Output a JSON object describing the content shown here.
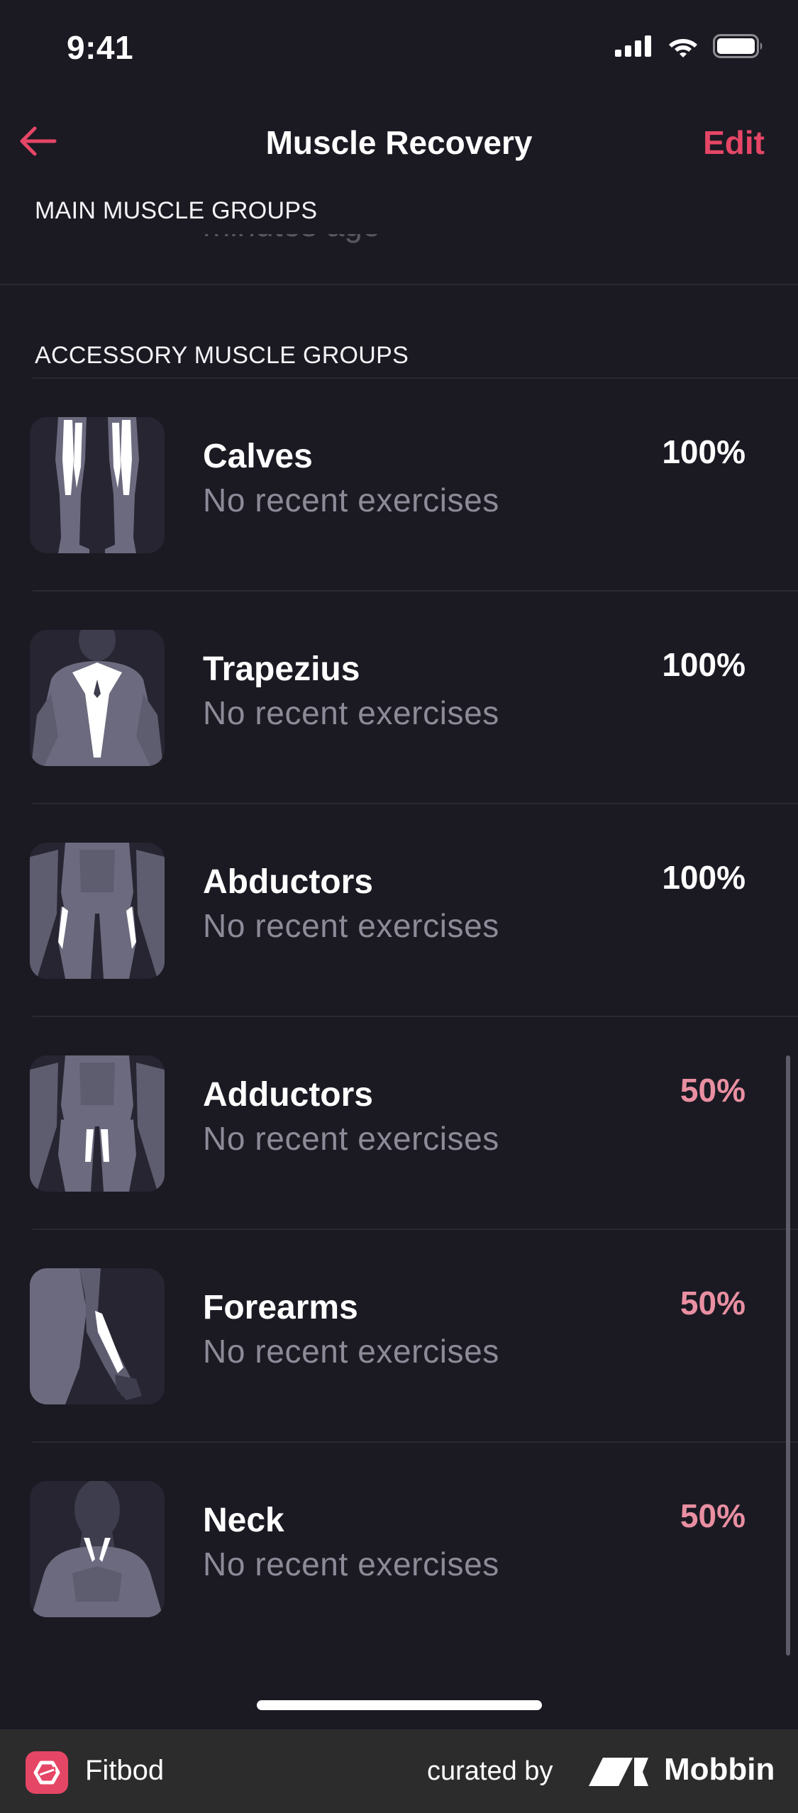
{
  "status_bar": {
    "time": "9:41"
  },
  "nav": {
    "title": "Muscle Recovery",
    "edit_label": "Edit",
    "accent": "#e64666"
  },
  "sections": {
    "main_header": "MAIN MUSCLE GROUPS",
    "main_partial_subtitle": "minutes ago ›",
    "accessory_header": "ACCESSORY MUSCLE GROUPS"
  },
  "muscles": [
    {
      "name": "Calves",
      "subtitle": "No recent exercises",
      "percent": "100%",
      "icon": "calves-icon"
    },
    {
      "name": "Trapezius",
      "subtitle": "No recent exercises",
      "percent": "100%",
      "icon": "trapezius-icon"
    },
    {
      "name": "Abductors",
      "subtitle": "No recent exercises",
      "percent": "100%",
      "icon": "abductors-icon"
    },
    {
      "name": "Adductors",
      "subtitle": "No recent exercises",
      "percent": "50%",
      "icon": "adductors-icon"
    },
    {
      "name": "Forearms",
      "subtitle": "No recent exercises",
      "percent": "50%",
      "icon": "forearms-icon"
    },
    {
      "name": "Neck",
      "subtitle": "No recent exercises",
      "percent": "50%",
      "icon": "neck-icon"
    }
  ],
  "colors": {
    "full_recovery": "#ffffff",
    "partial_recovery": "#e98fa1",
    "background": "#1b1a23"
  },
  "footer": {
    "app_name": "Fitbod",
    "curated_by": "curated by",
    "brand": "Mobbin"
  }
}
